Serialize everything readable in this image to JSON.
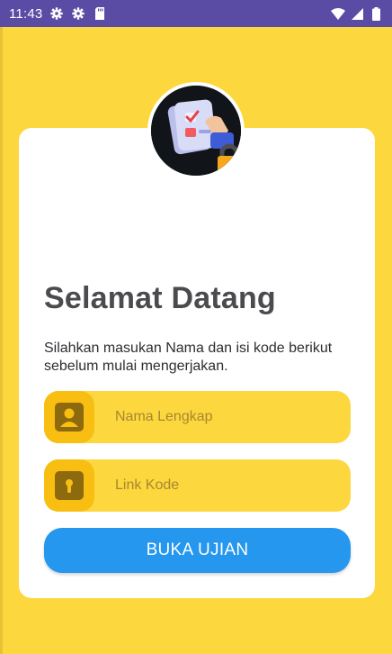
{
  "status_bar": {
    "time": "11:43",
    "left_icons": [
      "gear-icon",
      "gear-icon",
      "sd-card-icon"
    ],
    "right_icons": [
      "wifi-icon",
      "signal-icon",
      "battery-icon"
    ],
    "background": "#5A4BA4"
  },
  "screen": {
    "background": "#FDD73E"
  },
  "card": {
    "title": "Selamat Datang",
    "subtitle": "Silahkan masukan Nama dan isi kode berikut sebelum mulai mengerjakan.",
    "avatar_icon": "checklist-lock-illustration"
  },
  "fields": {
    "name": {
      "placeholder": "Nama Lengkap",
      "value": "",
      "icon": "user-icon"
    },
    "code": {
      "placeholder": "Link Kode",
      "value": "",
      "icon": "keyhole-icon"
    }
  },
  "button": {
    "label": "BUKA UJIAN",
    "color": "#2597EE"
  }
}
